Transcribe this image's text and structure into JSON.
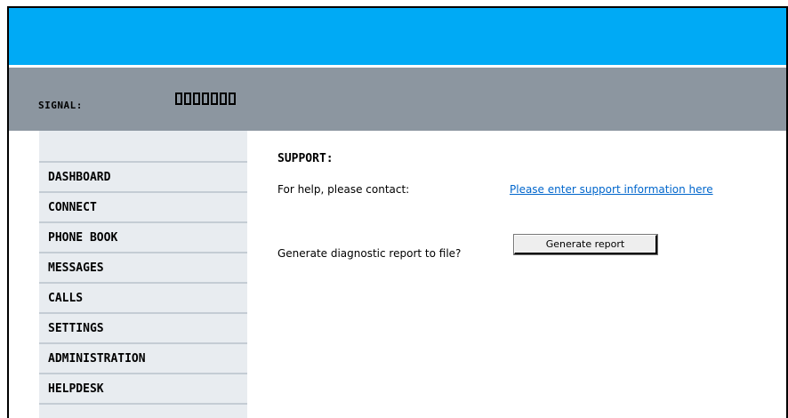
{
  "status": {
    "signal_label": "SIGNAL:",
    "signal_bars_total": 7,
    "signal_bars_filled": 0
  },
  "sidebar": {
    "items": [
      {
        "label": "DASHBOARD"
      },
      {
        "label": "CONNECT"
      },
      {
        "label": "PHONE BOOK"
      },
      {
        "label": "MESSAGES"
      },
      {
        "label": "CALLS"
      },
      {
        "label": "SETTINGS"
      },
      {
        "label": "ADMINISTRATION"
      },
      {
        "label": "HELPDESK"
      }
    ]
  },
  "main": {
    "title": "SUPPORT:",
    "help_text": "For help, please contact:",
    "help_link": "Please enter support information here",
    "diagnostic_text": "Generate diagnostic report to file?",
    "generate_button": "Generate report"
  },
  "colors": {
    "topbar": "#00aaf5",
    "statusbar": "#8c96a0",
    "sidebar": "#e8ecf0",
    "link": "#0066cc"
  }
}
